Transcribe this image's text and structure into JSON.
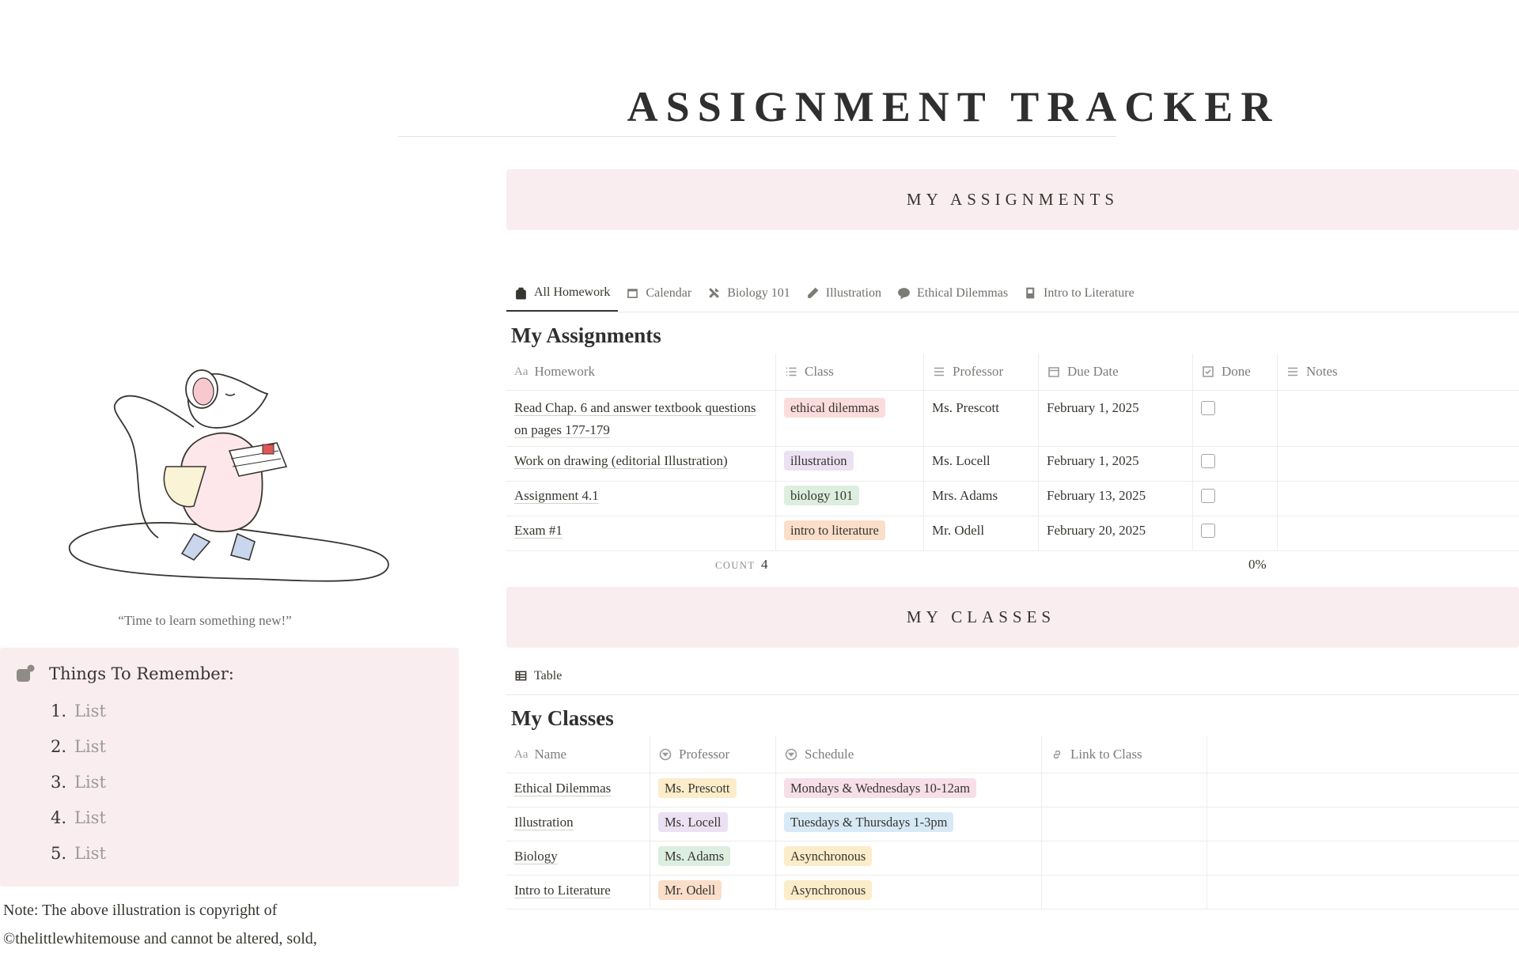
{
  "page": {
    "title": "ASSIGNMENT TRACKER"
  },
  "sections": {
    "assignments_banner": "MY ASSIGNMENTS",
    "classes_banner": "MY CLASSES"
  },
  "assignments_view": {
    "tabs": [
      {
        "label": "All Homework",
        "icon": "backpack-icon",
        "active": true
      },
      {
        "label": "Calendar",
        "icon": "calendar-icon"
      },
      {
        "label": "Biology 101",
        "icon": "tools-icon"
      },
      {
        "label": "Illustration",
        "icon": "pencil-icon"
      },
      {
        "label": "Ethical Dilemmas",
        "icon": "speech-bubble-icon"
      },
      {
        "label": "Intro to Literature",
        "icon": "book-icon"
      }
    ],
    "title": "My Assignments",
    "columns": [
      "Homework",
      "Class",
      "Professor",
      "Due Date",
      "Done",
      "Notes"
    ],
    "column_type_icons": {
      "Homework": "Aa",
      "Class": "list-icon",
      "Professor": "text-icon",
      "Due Date": "calendar-icon",
      "Done": "checkbox-icon",
      "Notes": "text-icon"
    },
    "rows": [
      {
        "homework": "Read Chap. 6 and answer textbook questions on pages 177-179",
        "class": "ethical dilemmas",
        "class_color": "red",
        "professor": "Ms. Prescott",
        "due": "February 1, 2025",
        "done": false
      },
      {
        "homework": "Work on drawing (editorial Illustration)",
        "class": "illustration",
        "class_color": "purple",
        "professor": "Ms. Locell",
        "due": "February 1, 2025",
        "done": false
      },
      {
        "homework": "Assignment 4.1",
        "class": "biology 101",
        "class_color": "green",
        "professor": "Mrs. Adams",
        "due": "February 13, 2025",
        "done": false
      },
      {
        "homework": "Exam #1",
        "class": "intro to literature",
        "class_color": "orange",
        "professor": "Mr. Odell",
        "due": "February 20, 2025",
        "done": false
      }
    ],
    "summary": {
      "count_label": "COUNT",
      "count_value": "4",
      "done_percent": "0%"
    }
  },
  "classes_view": {
    "view_tab": {
      "label": "Table",
      "icon": "table-icon"
    },
    "title": "My Classes",
    "columns": [
      "Name",
      "Professor",
      "Schedule",
      "Link to Class"
    ],
    "column_type_icons": {
      "Name": "Aa",
      "Professor": "select-icon",
      "Schedule": "select-icon",
      "Link to Class": "link-icon"
    },
    "rows": [
      {
        "name": "Ethical Dilemmas",
        "professor": "Ms. Prescott",
        "professor_color": "yellow",
        "schedule": "Mondays & Wednesdays 10-12am",
        "schedule_color": "pink",
        "link": ""
      },
      {
        "name": "Illustration",
        "professor": "Ms. Locell",
        "professor_color": "purple",
        "schedule": "Tuesdays & Thursdays 1-3pm",
        "schedule_color": "blue",
        "link": ""
      },
      {
        "name": "Biology",
        "professor": "Ms. Adams",
        "professor_color": "green",
        "schedule": "Asynchronous",
        "schedule_color": "yellow",
        "link": ""
      },
      {
        "name": "Intro to Literature",
        "professor": "Mr. Odell",
        "professor_color": "orange",
        "schedule": "Asynchronous",
        "schedule_color": "yellow",
        "link": ""
      }
    ]
  },
  "sidebar": {
    "illustration": "mouse-reading-book-illustration",
    "caption": "“Time to learn something new!”",
    "callout": {
      "icon": "bubble-dot-icon",
      "heading": "Things To Remember:",
      "items": [
        {
          "num": "1.",
          "text": "List"
        },
        {
          "num": "2.",
          "text": "List"
        },
        {
          "num": "3.",
          "text": "List"
        },
        {
          "num": "4.",
          "text": "List"
        },
        {
          "num": "5.",
          "text": "List"
        }
      ]
    },
    "note_line1": "Note: The above illustration is copyright of",
    "note_line2": "©thelittlewhitemouse and cannot be altered, sold,"
  },
  "colors": {
    "banner_bg": "#f9edf0",
    "callout_bg": "#f9edf0",
    "text": "#37352f",
    "muted": "#787774"
  }
}
